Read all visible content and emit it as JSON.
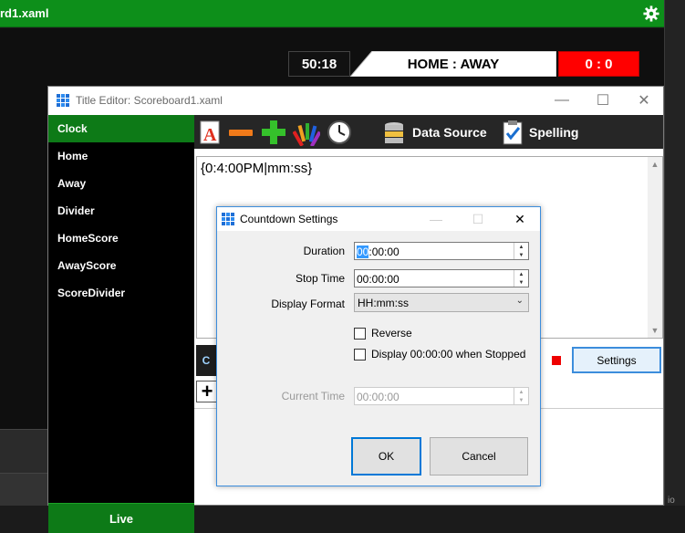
{
  "app": {
    "title": "rd1.xaml",
    "gear_icon": "gear-icon",
    "io_text": "io"
  },
  "scoreboard": {
    "clock": "50:18",
    "title": "HOME : AWAY",
    "score": "0 : 0",
    "colors": {
      "score_bg": "#ff0000",
      "clock_bg": "#111111"
    }
  },
  "editor": {
    "title": "Title Editor: Scoreboard1.xaml",
    "items": [
      {
        "label": "Clock",
        "active": true
      },
      {
        "label": "Home",
        "active": false
      },
      {
        "label": "Away",
        "active": false
      },
      {
        "label": "Divider",
        "active": false
      },
      {
        "label": "HomeScore",
        "active": false
      },
      {
        "label": "AwayScore",
        "active": false
      },
      {
        "label": "ScoreDivider",
        "active": false
      }
    ],
    "live_label": "Live",
    "toolbar": {
      "font_icon": "font-icon",
      "remove_icon": "minus-icon",
      "add_icon": "plus-icon",
      "palette_icon": "color-palette-icon",
      "clock_icon": "clock-icon",
      "data_source_label": "Data Source",
      "spelling_label": "Spelling"
    },
    "text_content": "{0:4:00PM|mm:ss}",
    "settings_label": "Settings",
    "add_label": "+",
    "ctrl_partial": "C",
    "accent": "#0d7a17"
  },
  "dialog": {
    "title": "Countdown Settings",
    "duration_label": "Duration",
    "duration_selected": "00",
    "duration_rest": ":00:00",
    "stop_time_label": "Stop Time",
    "stop_time_value": "00:00:00",
    "display_format_label": "Display Format",
    "display_format_value": "HH:mm:ss",
    "reverse_label": "Reverse",
    "reverse_checked": false,
    "display_zero_label": "Display 00:00:00 when Stopped",
    "display_zero_checked": false,
    "current_time_label": "Current Time",
    "current_time_value": "00:00:00",
    "ok_label": "OK",
    "cancel_label": "Cancel"
  }
}
